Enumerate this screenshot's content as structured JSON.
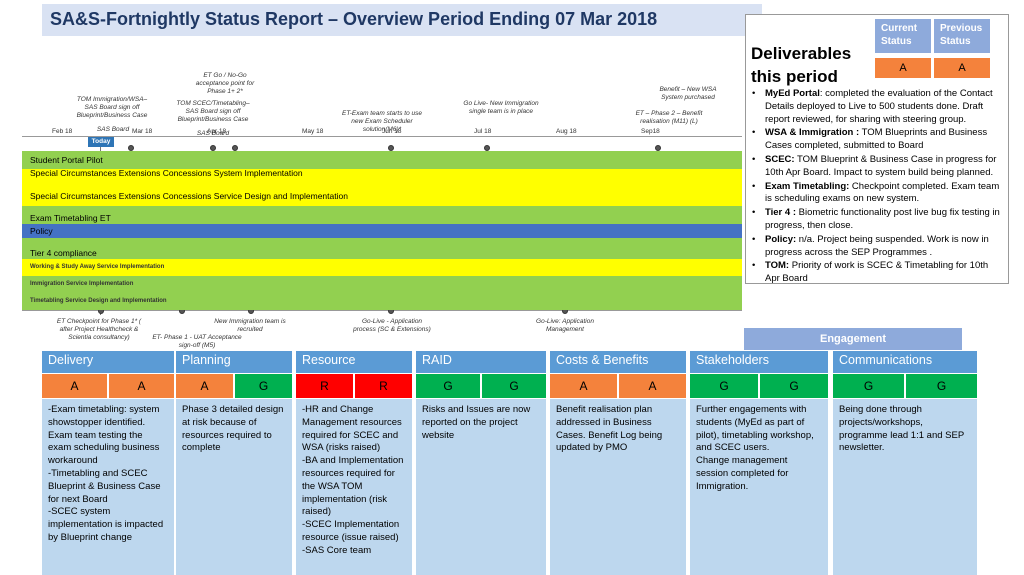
{
  "title": "SA&S-Fortnightly Status Report – Overview Period Ending 07 Mar 2018",
  "deliverables": {
    "heading": "Deliverables this period",
    "current_label": "Current Status",
    "previous_label": "Previous Status",
    "current_value": "A",
    "previous_value": "A",
    "items": [
      {
        "lead": "MyEd Portal",
        "text": ": completed the evaluation of the Contact Details  deployed to Live to 500 students done. Draft report reviewed, for sharing with steering group."
      },
      {
        "lead": "WSA & Immigration :",
        "text": " TOM Blueprints and Business Cases completed, submitted to Board"
      },
      {
        "lead": "SCEC:",
        "text": " TOM Blueprint & Business Case in progress for 10th Apr Board. Impact to system build being planned."
      },
      {
        "lead": "Exam Timetabling:",
        "text": " Checkpoint completed. Exam team is scheduling exams on new system."
      },
      {
        "lead": "Tier 4 :",
        "text": "  Biometric functionality post live bug fix testing in progress, then close."
      },
      {
        "lead": "Policy:",
        "text": " n/a. Project being suspended. Work is now in progress across the SEP Programmes ."
      },
      {
        "lead": "TOM:",
        "text": " Priority of work is SCEC & Timetabling for 10th Apr Board"
      }
    ]
  },
  "timeline": {
    "today_label": "Today",
    "months": [
      "Feb 18",
      "Mar 18",
      "Apr 18",
      "May 18",
      "Jun 18",
      "Jul 18",
      "Aug 18",
      "Sep18"
    ],
    "top_annotations": [
      "TOM Immigration/WSA– SAS Board sign off Blueprint/Business Case",
      "SAS Board",
      "ET Go / No-Go acceptance point for Phase 1+ 2*",
      "TOM SCEC/Timetabling– SAS Board sign off Blueprint/Business Case",
      "SAS Board",
      "ET-Exam team starts to use new Exam Scheduler solution(M6)*",
      "Go Live- New Immigration single team is in place",
      "Benefit – New WSA System purchased",
      "ET – Phase 2 – Benefit realisation (M11) (L)"
    ],
    "bottom_annotations": [
      "ET Checkpoint for Phase 1* ( after Project Healthcheck & Scientia consultancy)",
      "ET- Phase 1 - UAT Acceptance sign-off (M5)",
      "New Immigration team is recruited",
      "Go-Live - Application process (SC & Extensions)",
      "Go-Live: Application Management"
    ],
    "bands": [
      "Student Portal Pilot",
      "Special Circumstances Extensions Concessions System Implementation",
      "Special Circumstances Extensions Concessions Service Design and Implementation",
      "Exam Timetabling ET",
      "Policy",
      "Tier 4 compliance",
      "Working & Study Away Service Implementation",
      "Immigration Service Implementation",
      "Timetabling Service Design and Implementation"
    ]
  },
  "engagement_label": "Engagement",
  "columns": [
    {
      "name": "Delivery",
      "s1": "A",
      "s2": "A",
      "body": "-Exam timetabling: system showstopper identified. Exam team testing the exam scheduling business workaround\n-Timetabling and SCEC Blueprint & Business Case for next Board\n-SCEC system implementation is impacted by Blueprint change"
    },
    {
      "name": "Planning",
      "s1": "A",
      "s2": "G",
      "body": "Phase 3 detailed design at risk because of resources required to complete"
    },
    {
      "name": "Resource",
      "s1": "R",
      "s2": "R",
      "body": "-HR and Change Management resources required for SCEC and WSA (risks raised)\n-BA and Implementation resources required for the WSA TOM implementation (risk raised)\n-SCEC Implementation resource (issue raised)\n-SAS Core team"
    },
    {
      "name": "RAID",
      "s1": "G",
      "s2": "G",
      "body": "Risks and Issues are now reported on the project website"
    },
    {
      "name": "Costs & Benefits",
      "s1": "A",
      "s2": "A",
      "body": "Benefit realisation plan addressed in Business Cases. Benefit Log being updated by PMO"
    },
    {
      "name": "Stakeholders",
      "s1": "G",
      "s2": "G",
      "body": "Further engagements with students (MyEd as part of pilot), timetabling workshop, and SCEC users.\nChange management session completed for Immigration."
    },
    {
      "name": "Communications",
      "s1": "G",
      "s2": "G",
      "body": "Being done through projects/workshops, programme lead 1:1 and SEP newsletter."
    }
  ],
  "colors": {
    "amber": "#f4823c",
    "green": "#00b050",
    "red": "#ff0000",
    "header_blue": "#5b9bd5",
    "body_blue": "#bdd7ee"
  }
}
